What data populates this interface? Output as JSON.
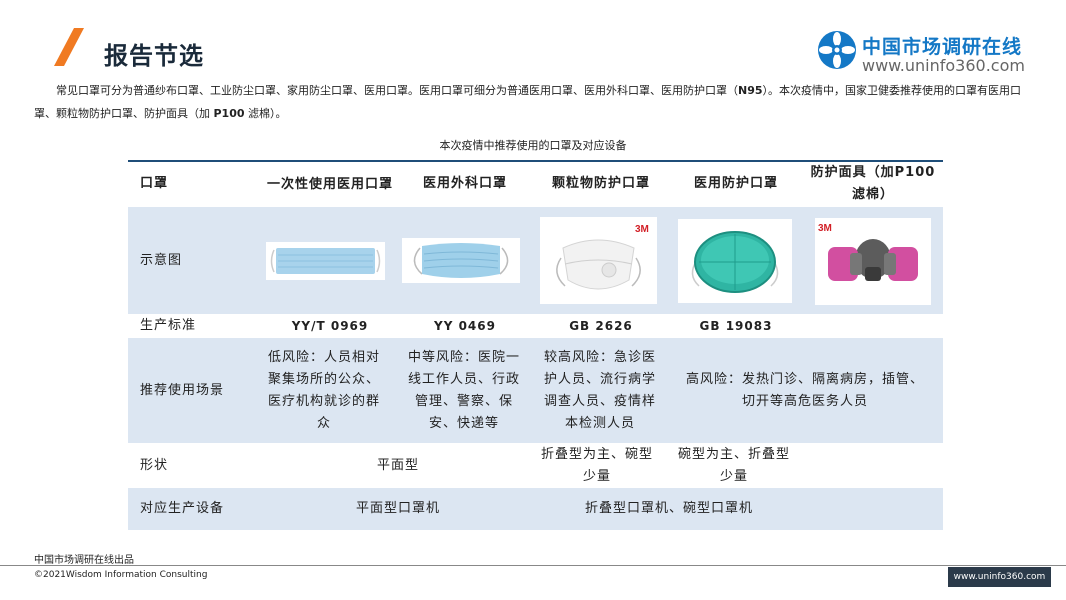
{
  "header": {
    "title": "报告节选",
    "logo_name": "中国市场调研在线",
    "logo_url": "www.uninfo360.com",
    "accent": "#f07a22",
    "brand_blue": "#1478c6"
  },
  "intro": {
    "part1": "常见口罩可分为普通纱布口罩、工业防尘口罩、家用防尘口罩、医用口罩。医用口罩可细分为普通医用口罩、医用外科口罩、医用防护口罩（",
    "n95": "N95",
    "part2": "）。本次疫情中，国家卫健委推荐使用的口罩有医用口罩、颗粒物防护口罩、防护面具（加 ",
    "p100": "P100",
    "part3": " 滤棉）。"
  },
  "table": {
    "caption": "本次疫情中推荐使用的口罩及对应设备",
    "headers": [
      "口罩",
      "一次性使用医用口罩",
      "医用外科口罩",
      "颗粒物防护口罩",
      "医用防护口罩",
      "防护面具（加P100滤棉）"
    ],
    "row_image_label": "示意图",
    "row_standard": {
      "label": "生产标准",
      "values": [
        "YY/T 0969",
        "YY 0469",
        "GB 2626",
        "GB 19083",
        ""
      ]
    },
    "row_scenario": {
      "label": "推荐使用场景",
      "values": [
        "低风险：人员相对聚集场所的公众、医疗机构就诊的群众",
        "中等风险：医院一线工作人员、行政管理、警察、保安、快递等",
        "较高风险：急诊医护人员、流行病学调查人员、疫情样本检测人员",
        "高风险：发热门诊、隔离病房，插管、切开等高危医务人员"
      ]
    },
    "row_shape": {
      "label": "形状",
      "flat": "平面型",
      "folded1": "折叠型为主、碗型少量",
      "folded2": "碗型为主、折叠型少量"
    },
    "row_equipment": {
      "label": "对应生产设备",
      "flat": "平面型口罩机",
      "folded": "折叠型口罩机、碗型口罩机"
    },
    "brand_3m": "3M"
  },
  "footer": {
    "brand": "中国市场调研在线出品",
    "copyright": "©2021Wisdom Information Consulting",
    "url": "www.uninfo360.com"
  }
}
